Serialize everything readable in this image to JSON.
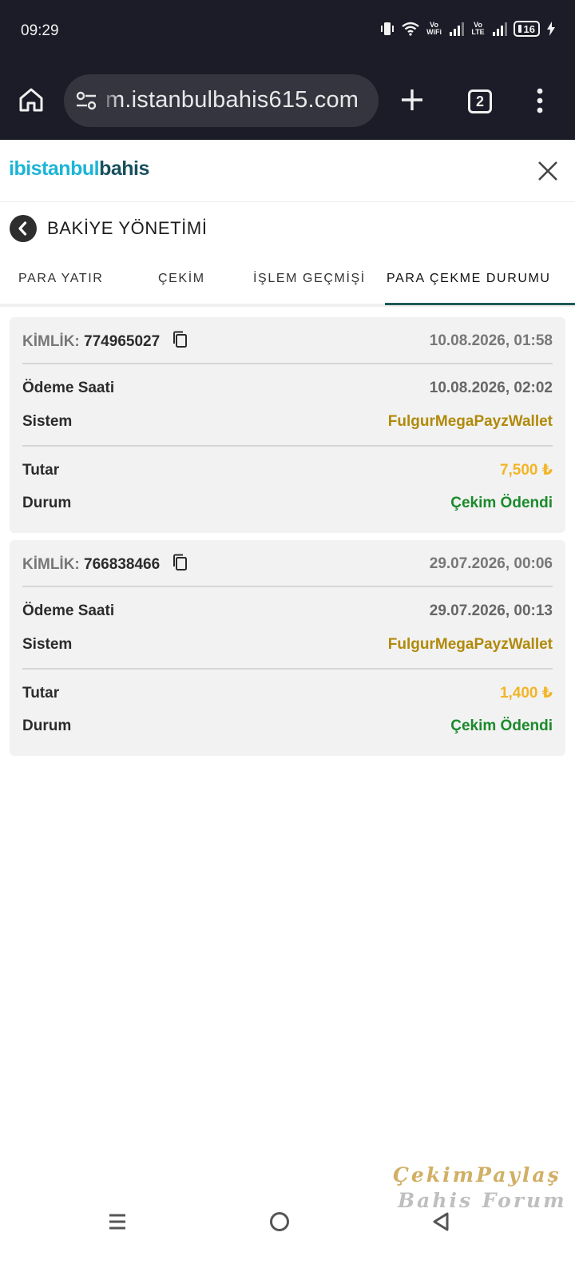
{
  "status": {
    "time": "09:29",
    "vowifi": "Vo WiFi",
    "volte": "Vo LTE",
    "battery": "16"
  },
  "browser": {
    "url": "m.istanbulbahis615.com",
    "tab_count": "2",
    "icons": [
      "home-icon",
      "tune-icon",
      "plus-icon",
      "tabs-icon",
      "more-vert-icon"
    ]
  },
  "site": {
    "logo_mark": "ib",
    "logo_part1": "istanbul",
    "logo_part2": "bahis",
    "close_icon": "close-icon"
  },
  "page": {
    "title": "BAKİYE YÖNETİMİ"
  },
  "tabs": [
    {
      "label": "PARA YATIR",
      "active": false
    },
    {
      "label": "ÇEKİM",
      "active": false
    },
    {
      "label": "İŞLEM GEÇMİŞİ",
      "active": false
    },
    {
      "label": "PARA ÇEKME DURUMU",
      "active": true
    }
  ],
  "labels": {
    "id": "KİMLİK:",
    "payment_time": "Ödeme Saati",
    "system": "Sistem",
    "amount": "Tutar",
    "status": "Durum"
  },
  "withdrawals": [
    {
      "id": "774965027",
      "created": "10.08.2026, 01:58",
      "payment_time": "10.08.2026, 02:02",
      "system": "FulgurMegaPayzWallet",
      "amount": "7,500 ₺",
      "status": "Çekim Ödendi"
    },
    {
      "id": "766838466",
      "created": "29.07.2026, 00:06",
      "payment_time": "29.07.2026, 00:13",
      "system": "FulgurMegaPayzWallet",
      "amount": "1,400 ₺",
      "status": "Çekim Ödendi"
    }
  ],
  "colors": {
    "tab_underline": "#1e5a56",
    "system_text": "#b08a0a",
    "amount_text": "#f3b526",
    "status_paid": "#1a8a2b"
  },
  "watermark": {
    "line1": "ÇekimPaylaş",
    "line2": "Bahis Forum"
  }
}
